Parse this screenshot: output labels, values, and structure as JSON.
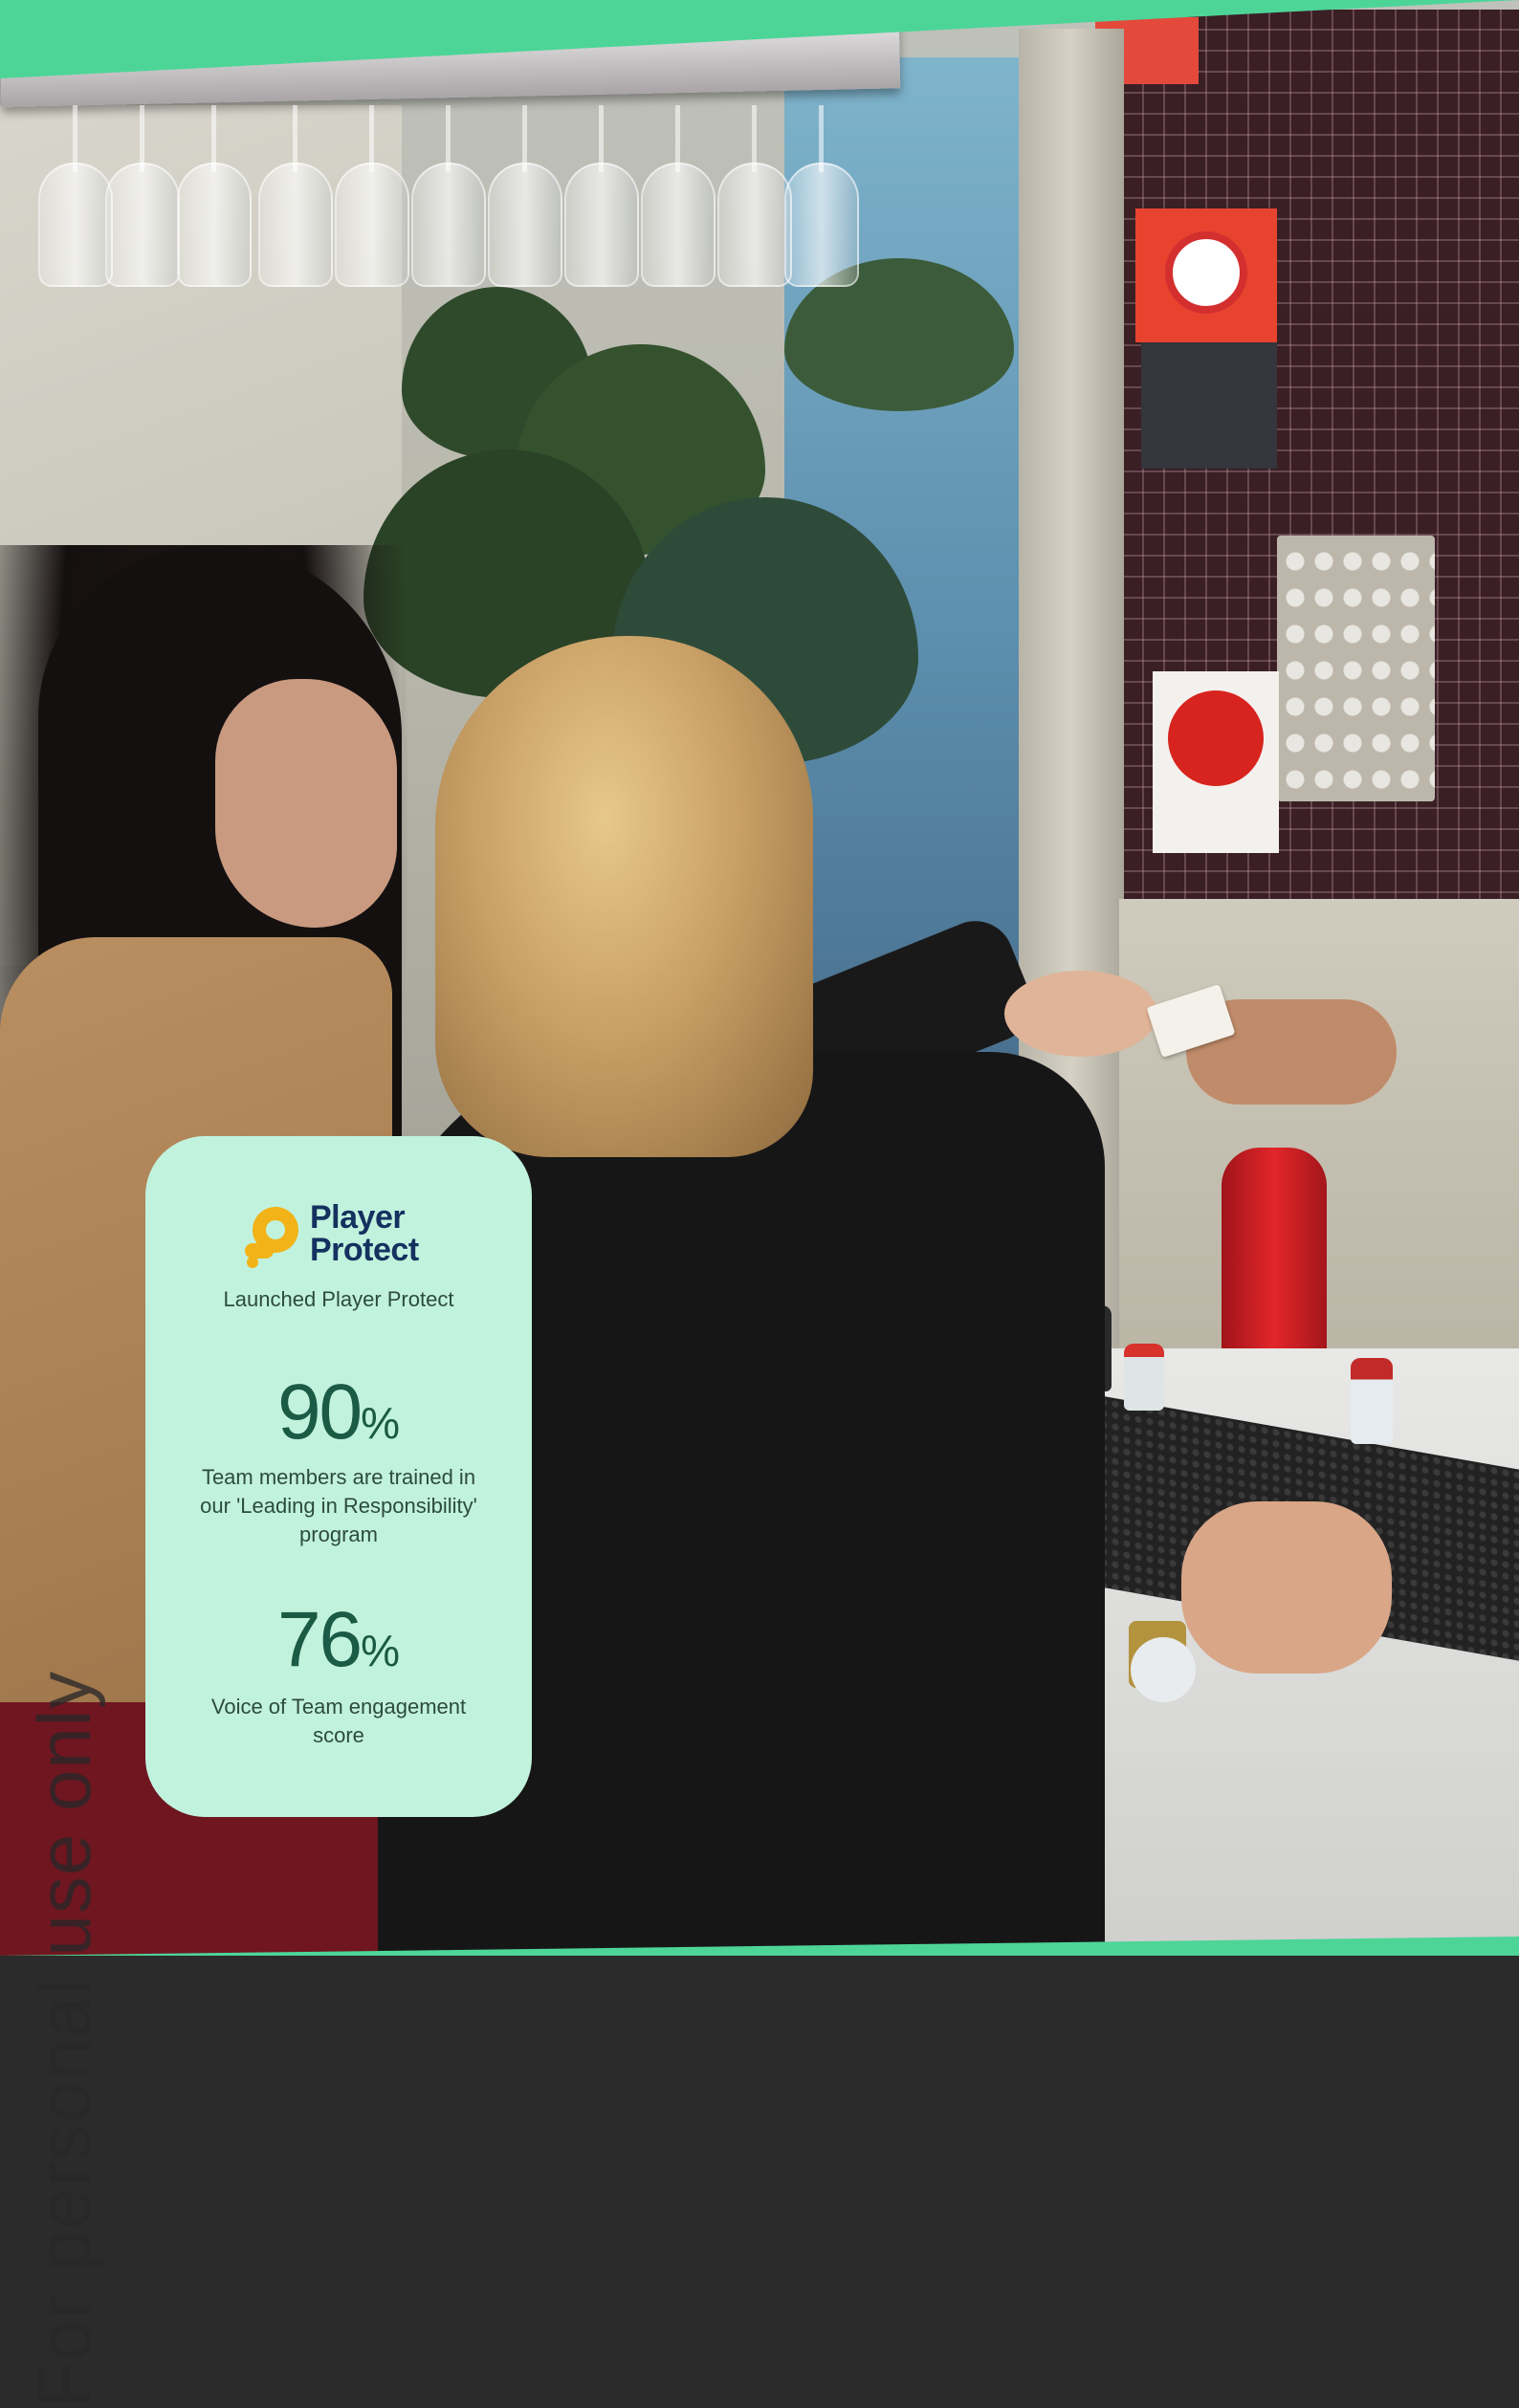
{
  "watermark": {
    "text": "For personal use only"
  },
  "card": {
    "logo": {
      "line1": "Player",
      "line2": "Protect",
      "icon": "player-protect-logo-icon"
    },
    "launch_caption": "Launched Player Protect",
    "stats": [
      {
        "value": "90",
        "unit": "%",
        "description": "Team members are trained in our 'Leading in Responsibility' program"
      },
      {
        "value": "76",
        "unit": "%",
        "description": "Voice of Team engagement score"
      }
    ]
  },
  "colors": {
    "accent_green": "#4dd598",
    "card_background": "#c1f2dd",
    "stat_color": "#1b5a45",
    "logo_blue": "#14315f",
    "logo_yellow": "#f2b318"
  }
}
